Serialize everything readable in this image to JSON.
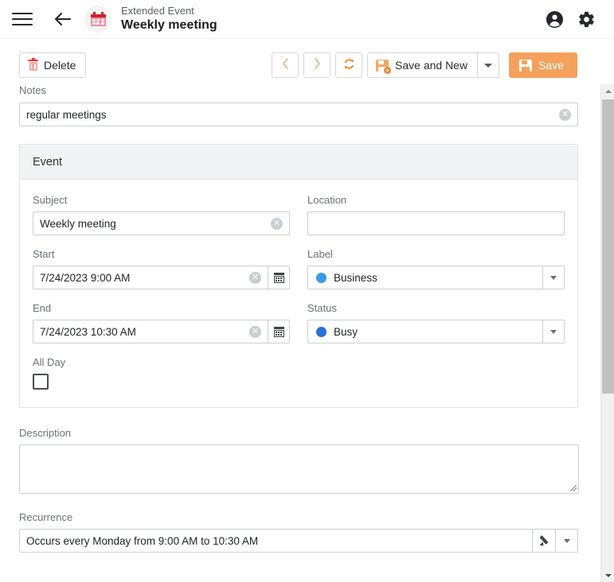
{
  "header": {
    "menu_icon": "hamburger-icon",
    "back_icon": "back-arrow-icon",
    "entity_icon": "calendar-icon",
    "supertitle": "Extended Event",
    "title": "Weekly meeting",
    "account_icon": "account-circle-icon",
    "settings_icon": "gear-icon"
  },
  "toolbar": {
    "delete_label": "Delete",
    "delete_icon": "trash-icon",
    "prev_icon": "chevron-left-icon",
    "next_icon": "chevron-right-icon",
    "refresh_icon": "refresh-icon",
    "save_and_new_label": "Save and New",
    "save_and_new_icon": "save-new-icon",
    "split_arrow_icon": "caret-down-icon",
    "save_label": "Save",
    "save_icon": "save-icon",
    "accent_color": "#f5a15c"
  },
  "form": {
    "notes": {
      "label": "Notes",
      "value": "regular meetings",
      "placeholder": "",
      "clear_icon": "clear-circle-icon"
    },
    "group": {
      "title": "Event",
      "subject": {
        "label": "Subject",
        "value": "Weekly meeting",
        "placeholder": "",
        "clear_icon": "clear-circle-icon"
      },
      "location": {
        "label": "Location",
        "value": "",
        "placeholder": ""
      },
      "start": {
        "label": "Start",
        "value": "7/24/2023 9:00 AM",
        "clear_icon": "clear-circle-icon",
        "picker_icon": "calendar-icon"
      },
      "end": {
        "label": "End",
        "value": "7/24/2023 10:30 AM",
        "clear_icon": "clear-circle-icon",
        "picker_icon": "calendar-icon"
      },
      "label_field": {
        "label": "Label",
        "value": "Business",
        "dot_color": "#3b9ae8",
        "arrow_icon": "caret-down-icon"
      },
      "status_field": {
        "label": "Status",
        "value": "Busy",
        "dot_color": "#2a6fdb",
        "arrow_icon": "caret-down-icon"
      },
      "all_day": {
        "label": "All Day",
        "checked": false
      }
    },
    "description": {
      "label": "Description",
      "value": "",
      "placeholder": "",
      "resize_icon": "resize-grip-icon"
    },
    "recurrence": {
      "label": "Recurrence",
      "value": "Occurs every Monday from 9:00 AM to 10:30 AM",
      "edit_icon": "pencil-icon",
      "arrow_icon": "caret-down-icon"
    }
  },
  "scrollbar": {
    "up_icon": "scroll-up-arrow-icon",
    "down_icon": "scroll-down-arrow-icon",
    "thumb": "scroll-thumb"
  }
}
